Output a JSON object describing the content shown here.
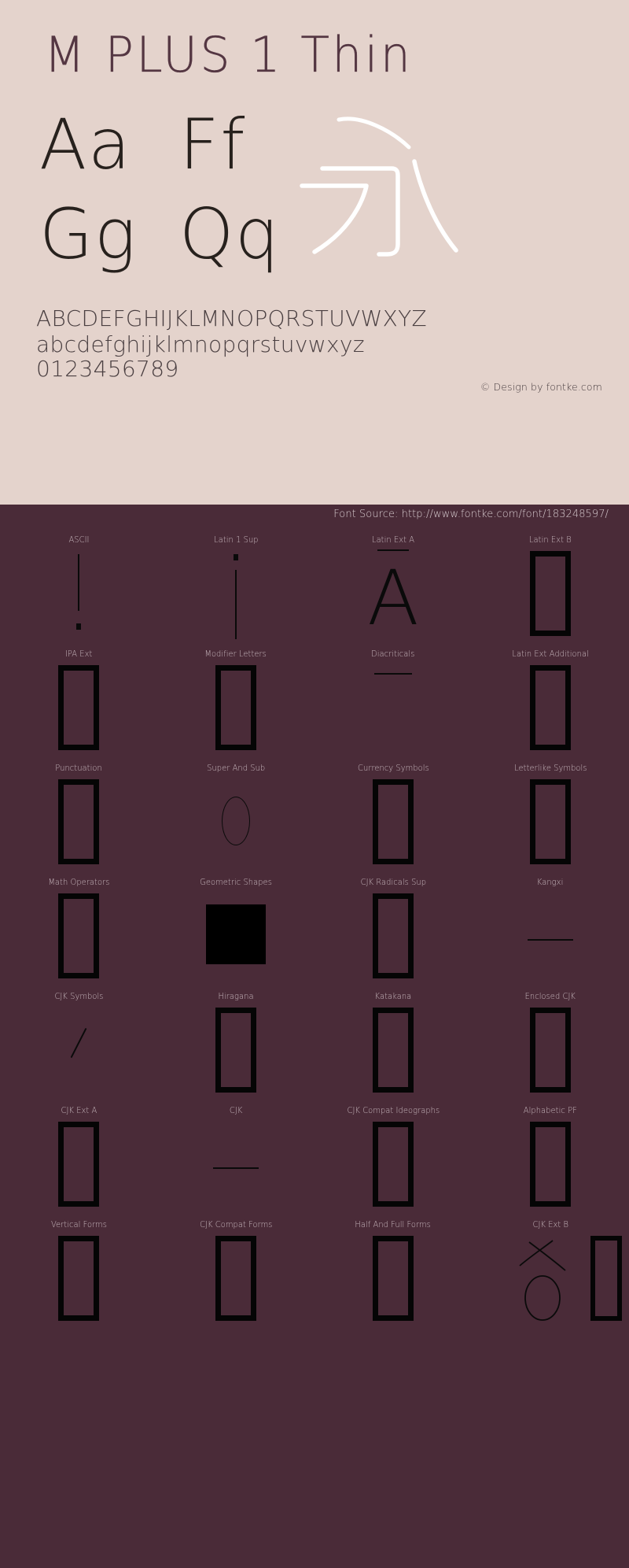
{
  "colors": {
    "specimen_bg": "#e4d3cc",
    "blocks_bg": "#4a2b38",
    "title_color": "#4a2b38",
    "glyph_color": "#17120f",
    "label_color": "#c9b9bf",
    "cjk_stroke": "#ffffff",
    "tofu_color": "#050505"
  },
  "specimen": {
    "title": "M PLUS 1 Thin",
    "glyph_pairs": [
      "Aa",
      "Ff",
      "Gg",
      "Qq"
    ],
    "cjk_sample_char": "永",
    "alphabet_rows": [
      "ABCDEFGHIJKLMNOPQRSTUVWXYZ",
      "abcdefghijklmnopqrstuvwxyz",
      "0123456789"
    ],
    "copyright": "© Design by fontke.com"
  },
  "blocks": {
    "font_source": "Font Source: http://www.fontke.com/font/183248597/",
    "items": [
      {
        "label": "ASCII",
        "sample": "exclam"
      },
      {
        "label": "Latin 1 Sup",
        "sample": "iexcl"
      },
      {
        "label": "Latin Ext A",
        "sample": "macron-a"
      },
      {
        "label": "Latin Ext B",
        "sample": "tofu"
      },
      {
        "label": "IPA Ext",
        "sample": "tofu"
      },
      {
        "label": "Modifier Letters",
        "sample": "tofu"
      },
      {
        "label": "Diacriticals",
        "sample": "hline-short"
      },
      {
        "label": "Latin Ext Additional",
        "sample": "tofu"
      },
      {
        "label": "Punctuation",
        "sample": "tofu"
      },
      {
        "label": "Super And Sub",
        "sample": "oval"
      },
      {
        "label": "Currency Symbols",
        "sample": "tofu"
      },
      {
        "label": "Letterlike Symbols",
        "sample": "tofu"
      },
      {
        "label": "Math Operators",
        "sample": "tofu"
      },
      {
        "label": "Geometric Shapes",
        "sample": "square"
      },
      {
        "label": "CJK Radicals Sup",
        "sample": "tofu"
      },
      {
        "label": "Kangxi",
        "sample": "hline-long"
      },
      {
        "label": "CJK Symbols",
        "sample": "slash"
      },
      {
        "label": "Hiragana",
        "sample": "tofu"
      },
      {
        "label": "Katakana",
        "sample": "tofu"
      },
      {
        "label": "Enclosed CJK",
        "sample": "tofu"
      },
      {
        "label": "CJK Ext A",
        "sample": "tofu"
      },
      {
        "label": "CJK",
        "sample": "hline-long"
      },
      {
        "label": "CJK Compat Ideographs",
        "sample": "tofu"
      },
      {
        "label": "Alphabetic PF",
        "sample": "tofu"
      },
      {
        "label": "Vertical Forms",
        "sample": "tofu"
      },
      {
        "label": "CJK Compat Forms",
        "sample": "tofu"
      },
      {
        "label": "Half And Full Forms",
        "sample": "tofu"
      },
      {
        "label": "CJK Ext B",
        "sample": "glyph-pair-x"
      }
    ]
  }
}
